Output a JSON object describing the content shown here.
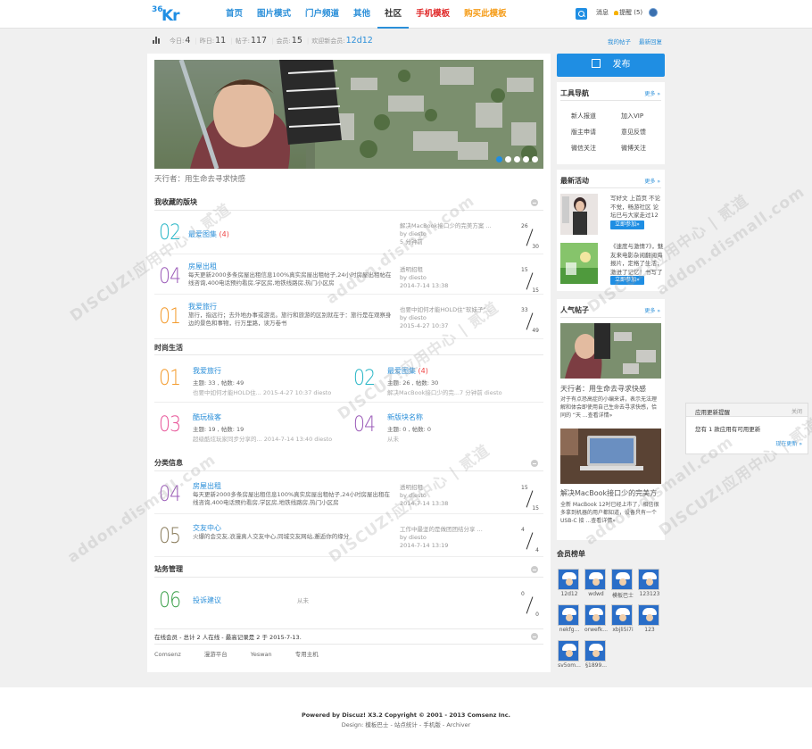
{
  "header": {
    "logo_num": "36",
    "logo_text": "Kr",
    "nav": [
      "首页",
      "图片模式",
      "门户频道",
      "其他",
      "社区",
      "手机模板",
      "购买此模板"
    ],
    "messages": "消息",
    "reminders": "提醒 (5)"
  },
  "stats": {
    "today_label": "今日:",
    "today": "4",
    "yesterday_label": "昨日:",
    "yesterday": "11",
    "posts_label": "帖子:",
    "posts": "117",
    "members_label": "会员:",
    "members": "15",
    "newest_label": "欢迎新会员:",
    "newest": "12d12",
    "my_posts": "我的帖子",
    "latest_replies": "最新回复"
  },
  "banner": {
    "caption": "天行者：用生命去寻求快感"
  },
  "sections": {
    "favorites": "我收藏的版块",
    "fashion": "时尚生活",
    "classified": "分类信息",
    "admin": "站务管理"
  },
  "favorites": [
    {
      "num": "02",
      "color": "#29b6c6",
      "name": "最爱图集",
      "count": "(4)",
      "desc": "",
      "last1": "解决MacBook接口少的完美方案 ...",
      "last2": "by diesto",
      "last3": "5 分钟前",
      "topics": "26",
      "posts": "30"
    },
    {
      "num": "04",
      "color": "#9b5bb8",
      "name": "房屋出租",
      "count": "",
      "desc": "每天更新2000多条房屋出租信息100%真实房屋出租帖子,24小时房屋出租帖在线咨询,400电话预约看房,学区房,地铁线路房,热门小区房",
      "last1": "透明招租",
      "last2": "by diesto",
      "last3": "2014-7-14 13:38",
      "topics": "15",
      "posts": "15"
    },
    {
      "num": "01",
      "color": "#f39a2b",
      "name": "我爱旅行",
      "count": "",
      "desc": "旅行，指远行；去外地办事或游览。旅行和旅游的区别就在于：旅行是在观察身边的景色和事物，行万里路，读万卷书",
      "last1": "也要中如何才能HOLD住“软妹子”...",
      "last2": "by diesto",
      "last3": "2015-4-27 10:37",
      "topics": "33",
      "posts": "49"
    }
  ],
  "fashion": [
    {
      "num": "01",
      "color": "#f39a2b",
      "name": "我爱旅行",
      "count": "",
      "stats": "主题: 33 , 帖数: 49",
      "last": "也要中如何才能HOLD住...  2015-4-27 10:37 diesto"
    },
    {
      "num": "02",
      "color": "#29b6c6",
      "name": "最爱图集",
      "count": "(4)",
      "stats": "主题: 26 , 帖数: 30",
      "last": "解决MacBook接口少的完...7 分钟前 diesto"
    },
    {
      "num": "03",
      "color": "#e8579a",
      "name": "酷玩极客",
      "count": "",
      "stats": "主题: 19 , 帖数: 19",
      "last": "超级酷炫玩家同步分享的...  2014-7-14 13:40 diesto"
    },
    {
      "num": "04",
      "color": "#9b5bb8",
      "name": "新版块名称",
      "count": "",
      "stats": "主题: 0 , 帖数: 0",
      "last": "从未"
    }
  ],
  "classified": [
    {
      "num": "04",
      "color": "#9b5bb8",
      "name": "房屋出租",
      "desc": "每天更新2000多条房屋出租信息100%真实房屋出租帖子,24小时房屋出租在线咨询,400电话预约看房,学区房,地铁线路房,热门小区房",
      "last1": "透明招租",
      "last2": "by diesto",
      "last3": "2014-7-14 13:38",
      "topics": "15",
      "posts": "15"
    },
    {
      "num": "05",
      "color": "#8a7c5c",
      "name": "交友中心",
      "desc": "火爆的会交友,浪漫真人交友中心,同城交友网站,邂逅你的缘分",
      "last1": "工作中最坚的是做团团结分享 ...",
      "last2": "by diesto",
      "last3": "2014-7-14 13:19",
      "topics": "4",
      "posts": "4"
    }
  ],
  "admin": [
    {
      "num": "06",
      "color": "#3ba04a",
      "name": "投诉建议",
      "last": "从未",
      "topics": "0",
      "posts": "0"
    }
  ],
  "online": "在线会员 - 总计 2 人在线 - 最高记录是 2 于 2015-7-13.",
  "friend_links": [
    "Comsenz",
    "漫游平台",
    "Yeswan",
    "专用主机"
  ],
  "footer": {
    "line1": "Powered by Discuz! X3.2 Copyright © 2001 - 2013 Comsenz Inc.",
    "line2": "Design: 模板巴士 - 站点统计 - 手机版 - Archiver"
  },
  "sidebar": {
    "publish": "发布",
    "tools_title": "工具导航",
    "more": "更多 »",
    "tools": [
      "新人报道",
      "加入VIP",
      "版主申请",
      "意见反馈",
      "微信关注",
      "微博关注"
    ],
    "activity_title": "最新活动",
    "activities": [
      {
        "text": "写好文 上首页 不论不觉，畅游社区 论坛已与大家走过12",
        "btn": "立即参加»"
      },
      {
        "text": "《速度与激情7》，魅友来电影杂阅翻阅海报片，定格了生活，激进了记忆！书写了",
        "btn": "立即参加»"
      }
    ],
    "hot_title": "人气帖子",
    "hot": [
      {
        "title": "天行者：用生命去寻求快感",
        "desc": "对于有点恐高症的小编来讲，表示无法理解和体会即使用自己生命去寻求快感，恰同的 “天 ...查看详情»"
      },
      {
        "title": "解决MacBook接口少的完美方",
        "desc": "全新 MacBook 12吋已经上市了，相信很多拿到机器的用户都知道，设备只有一个 USB-C 接 ...查看详情»"
      }
    ],
    "members_title": "会员榜单",
    "members": [
      "12d12",
      "wdwd",
      "模板巴士",
      "123123",
      "nekfg...",
      "orwefk...",
      "xbjli5i7i",
      "123",
      "sv5om...",
      "§1899..."
    ]
  },
  "notice": {
    "title": "应用更新提醒",
    "close": "关闭",
    "body": "您有 1 款应用有可用更新",
    "link": "现在更新 »"
  },
  "watermark": [
    "DISCUZ!应用中心 | 贰道",
    "addon.dismall.com"
  ],
  "colors": {
    "accent": "#1f8ee3",
    "hot": "#e02a2a",
    "buy": "#f59d1a"
  }
}
